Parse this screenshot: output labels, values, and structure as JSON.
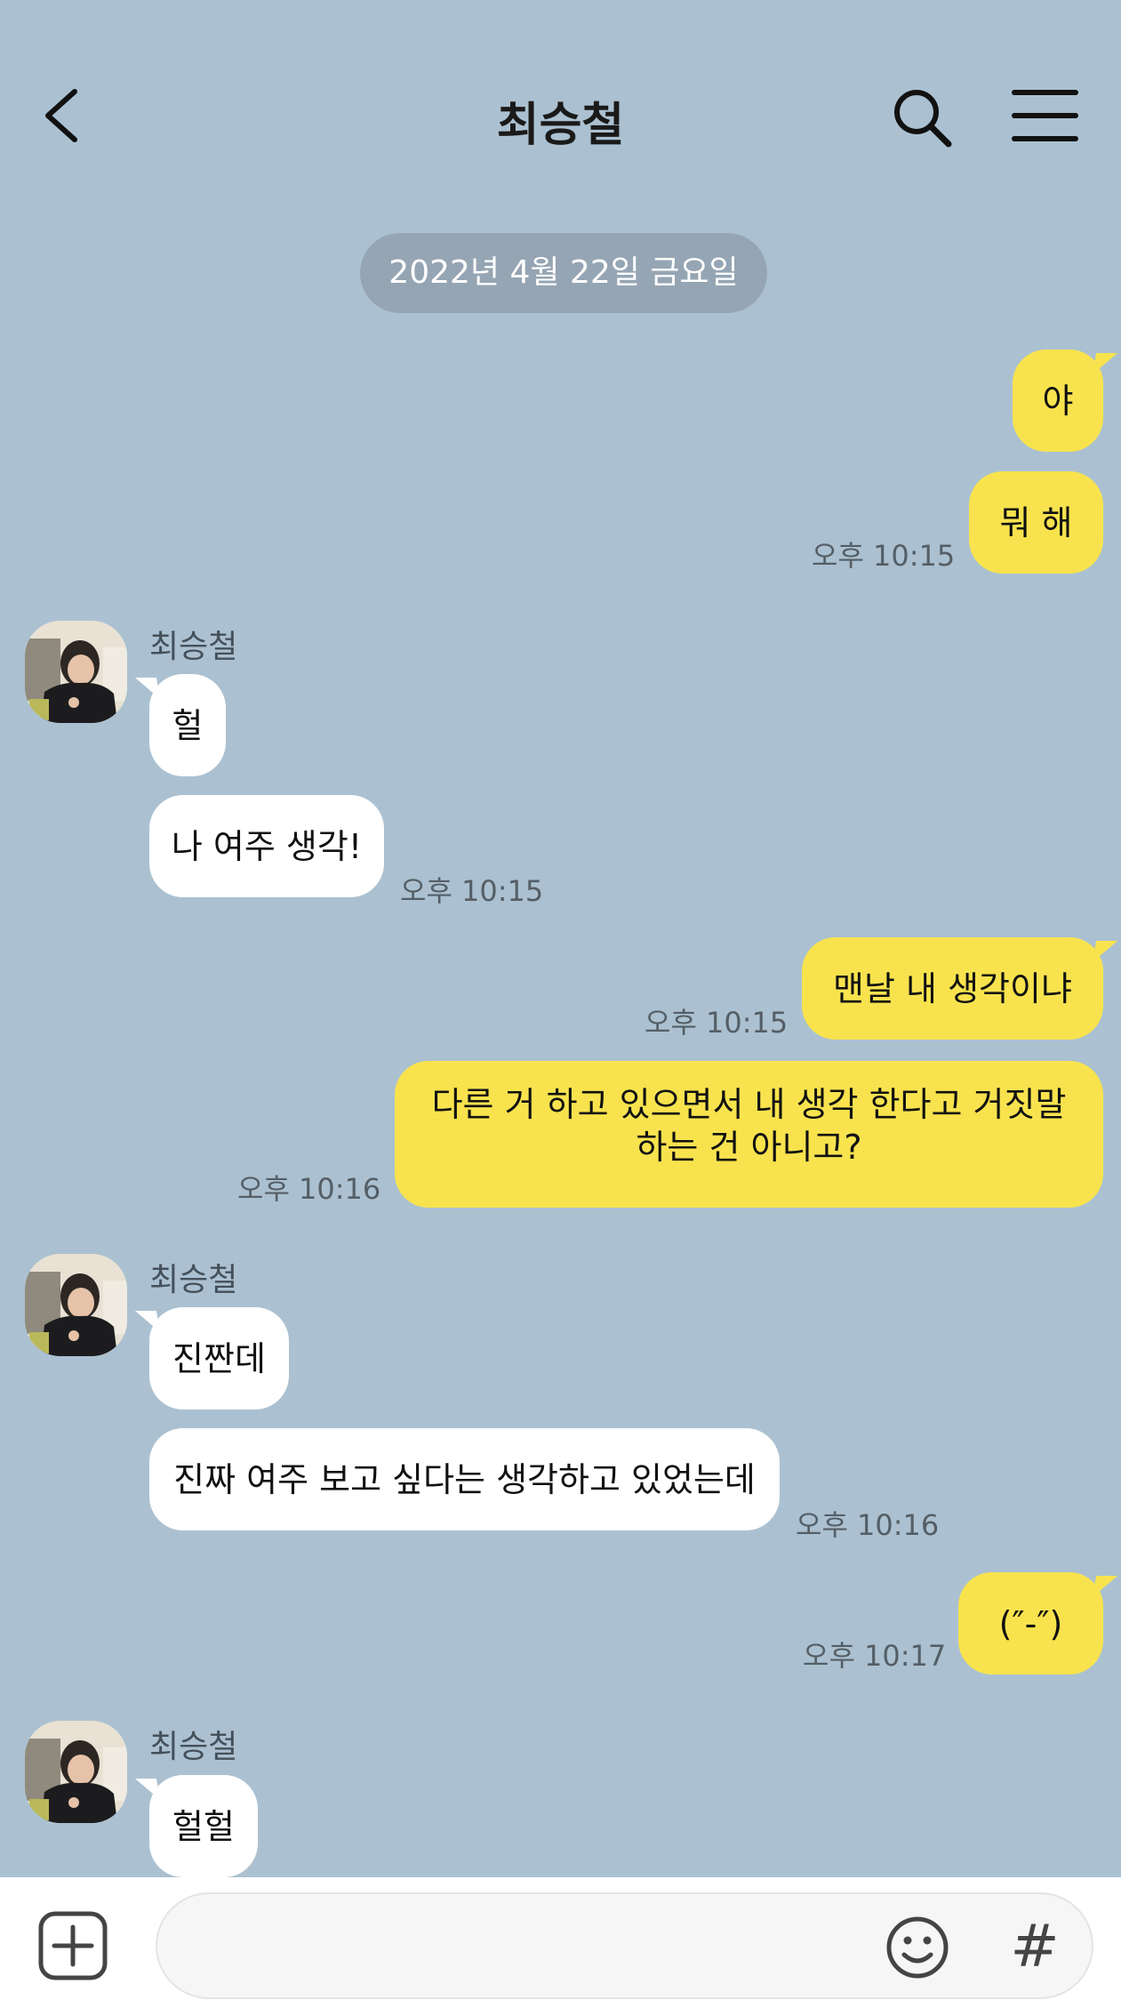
{
  "header": {
    "title": "최승철",
    "back_icon": "chevron-left-icon",
    "search_icon": "search-icon",
    "menu_icon": "hamburger-menu-icon"
  },
  "date_divider": "2022년 4월 22일 금요일",
  "messages": [
    {
      "from": "me",
      "text": "야"
    },
    {
      "from": "me",
      "text": "뭐 해",
      "time": "오후 10:15"
    },
    {
      "from": "other",
      "sender": "최승철",
      "text": "헐"
    },
    {
      "from": "other",
      "text": "나 여주 생각!",
      "time": "오후 10:15"
    },
    {
      "from": "me",
      "text": "맨날 내 생각이냐",
      "time": "오후 10:15"
    },
    {
      "from": "me",
      "text_line1": "다른 거 하고 있으면서 내 생각 한다고 거짓말",
      "text_line2": "하는 건 아니고?",
      "time": "오후 10:16"
    },
    {
      "from": "other",
      "sender": "최승철",
      "text": "진짠데"
    },
    {
      "from": "other",
      "text": "진짜 여주 보고 싶다는 생각하고 있었는데",
      "time": "오후 10:16"
    },
    {
      "from": "me",
      "text": "(″-″)",
      "time": "오후 10:17"
    },
    {
      "from": "other",
      "sender": "최승철",
      "text": "헐헐"
    }
  ],
  "input_bar": {
    "placeholder": "",
    "plus_icon": "plus-square-icon",
    "emoji_icon": "smiley-icon",
    "hashtag_label": "#"
  },
  "colors": {
    "background": "#abc1d1",
    "my_bubble": "#f8e34e",
    "their_bubble": "#ffffff",
    "date_pill": "#95a5b3"
  }
}
